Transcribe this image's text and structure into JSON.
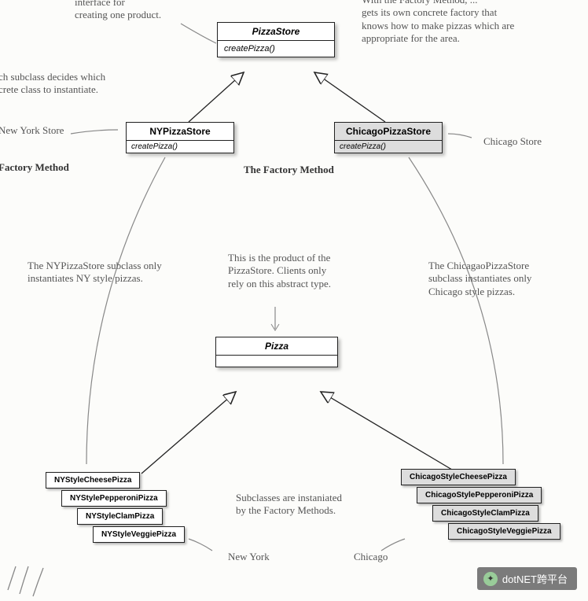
{
  "classes": {
    "pizzaStore": {
      "name": "PizzaStore",
      "method": "createPizza()"
    },
    "nyPizzaStore": {
      "name": "NYPizzaStore",
      "method": "createPizza()"
    },
    "chicagoPizzaStore": {
      "name": "ChicagoPizzaStore",
      "method": "createPizza()"
    },
    "pizza": {
      "name": "Pizza"
    }
  },
  "nyPizzas": [
    "NYStyleCheesePizza",
    "NYStylePepperoniPizza",
    "NYStyleClamPizza",
    "NYStyleVeggiePizza"
  ],
  "chicagoPizzas": [
    "ChicagoStyleCheesePizza",
    "ChicagoStylePepperoniPizza",
    "ChicagoStyleClamPizza",
    "ChicagoStyleVeggiePizza"
  ],
  "annotations": {
    "topLeft": "interface for\ncreating one product.",
    "topRight": "With the Factory Method, ...\ngets its own concrete factory that\nknows how to make pizzas which are\nappropriate for the area.",
    "subclassDecides": "ch subclass decides which\ncrete class to instantiate.",
    "newYorkStore": "New York Store",
    "chicagoStore": "Chicago Store",
    "factoryMethodLeft": "Factory Method",
    "factoryMethodMid": "The Factory Method",
    "nySubclassNote": "The NYPizzaStore subclass only\ninstantiates NY style pizzas.",
    "productNote": "This is the product of the\nPizzaStore.  Clients only\nrely on this abstract type.",
    "chicagoSubclassNote": "The ChicagaoPizzaStore\nsubclass instantiates only\nChicago style pizzas.",
    "subclassesInstantiated": "Subclasses are instaniated\nby the Factory Methods.",
    "newYork": "New York",
    "chicago": "Chicago"
  },
  "watermark": "dotNET跨平台",
  "chart_data": {
    "type": "diagram",
    "pattern": "Factory Method",
    "nodes": [
      {
        "id": "PizzaStore",
        "stereotype": "abstract",
        "methods": [
          "createPizza()"
        ]
      },
      {
        "id": "NYPizzaStore",
        "extends": "PizzaStore",
        "methods": [
          "createPizza()"
        ]
      },
      {
        "id": "ChicagoPizzaStore",
        "extends": "PizzaStore",
        "methods": [
          "createPizza()"
        ]
      },
      {
        "id": "Pizza",
        "stereotype": "abstract"
      },
      {
        "id": "NYStyleCheesePizza",
        "extends": "Pizza"
      },
      {
        "id": "NYStylePepperoniPizza",
        "extends": "Pizza"
      },
      {
        "id": "NYStyleClamPizza",
        "extends": "Pizza"
      },
      {
        "id": "NYStyleVeggiePizza",
        "extends": "Pizza"
      },
      {
        "id": "ChicagoStyleCheesePizza",
        "extends": "Pizza"
      },
      {
        "id": "ChicagoStylePepperoniPizza",
        "extends": "Pizza"
      },
      {
        "id": "ChicagoStyleClamPizza",
        "extends": "Pizza"
      },
      {
        "id": "ChicagoStyleVeggiePizza",
        "extends": "Pizza"
      }
    ],
    "edges": [
      {
        "from": "NYPizzaStore",
        "to": "PizzaStore",
        "rel": "generalization"
      },
      {
        "from": "ChicagoPizzaStore",
        "to": "PizzaStore",
        "rel": "generalization"
      },
      {
        "from": "NYStyleCheesePizza",
        "to": "Pizza",
        "rel": "generalization"
      },
      {
        "from": "NYStylePepperoniPizza",
        "to": "Pizza",
        "rel": "generalization"
      },
      {
        "from": "NYStyleClamPizza",
        "to": "Pizza",
        "rel": "generalization"
      },
      {
        "from": "NYStyleVeggiePizza",
        "to": "Pizza",
        "rel": "generalization"
      },
      {
        "from": "ChicagoStyleCheesePizza",
        "to": "Pizza",
        "rel": "generalization"
      },
      {
        "from": "ChicagoStylePepperoniPizza",
        "to": "Pizza",
        "rel": "generalization"
      },
      {
        "from": "ChicagoStyleClamPizza",
        "to": "Pizza",
        "rel": "generalization"
      },
      {
        "from": "ChicagoStyleVeggiePizza",
        "to": "Pizza",
        "rel": "generalization"
      },
      {
        "from": "NYPizzaStore",
        "to": "NYStyle*Pizza",
        "rel": "creates"
      },
      {
        "from": "ChicagoPizzaStore",
        "to": "ChicagoStyle*Pizza",
        "rel": "creates"
      }
    ]
  }
}
